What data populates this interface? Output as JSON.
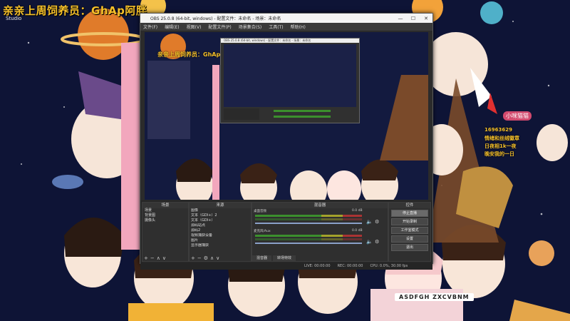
{
  "banner": {
    "title": "亲亲上周饲养员：GhAp阿胖",
    "subtitle": "Studio"
  },
  "obs": {
    "window_title": "OBS 25.0.8 (64-bit, windows) - 配置文件：未命名 - 场景：未命名",
    "menu": [
      "文件(F)",
      "编辑(E)",
      "视图(V)",
      "配置文件(P)",
      "场景集合(S)",
      "工具(T)",
      "帮助(H)"
    ],
    "overlay_title": "亲亲上周饲养员：GhAp阿胖",
    "docks": {
      "scenes": {
        "title": "场景",
        "items": [
          "场景",
          "背景图",
          "摄像头"
        ]
      },
      "sources": {
        "title": "来源",
        "items": [
          "图像",
          "文本（GDI+）2",
          "文本（GDI+）",
          "源码站点",
          "源码2",
          "视频捕获设备",
          "图片",
          "显示器捕获"
        ]
      },
      "mixer": {
        "title": "混音器",
        "tracks": [
          {
            "label": "桌面音频",
            "db": "0.0 dB"
          },
          {
            "label": "麦克风/Aux",
            "db": "0.0 dB"
          }
        ],
        "tabs": [
          "混音器",
          "转场特效"
        ]
      },
      "controls": {
        "title": "控件",
        "buttons": [
          "停止直播",
          "开始录制",
          "工作室模式",
          "设置",
          "退出"
        ]
      }
    },
    "status": {
      "live": "LIVE: 00:00:00",
      "rec": "REC: 00:00:00",
      "cpu": "CPU: 0.0%, 30.00 fps"
    }
  },
  "card": {
    "name": "小咪猫猫",
    "lines": [
      "16963629",
      "情绪和丝绒徽章",
      "日夜相1k一夜",
      "晚安我的一日"
    ]
  },
  "keyboard_label": "ASDFGH ZXCVBNM",
  "icons": [
    "close-icon",
    "minimize-icon",
    "maximize-icon",
    "add-icon",
    "remove-icon",
    "gear-icon",
    "up-arrow-icon",
    "down-arrow-icon",
    "eye-icon",
    "lock-icon"
  ],
  "colors": {
    "banner": "#f5c02a",
    "obs_bg": "#2b2b2b",
    "bg": "#0d1233",
    "pink": "#f2a7bd"
  }
}
